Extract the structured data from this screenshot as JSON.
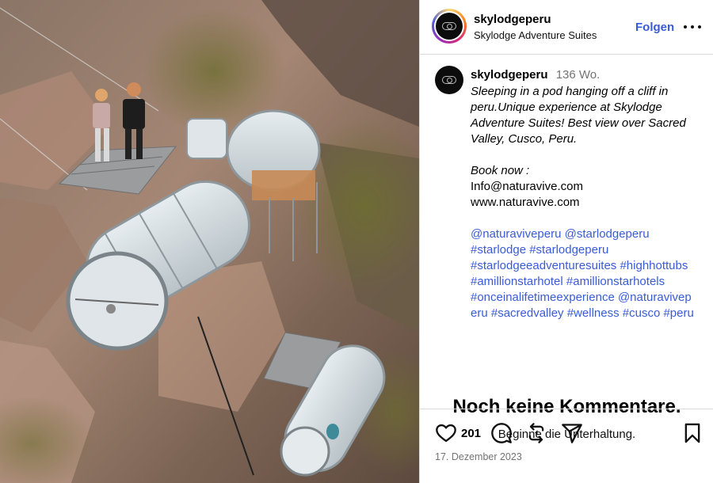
{
  "header": {
    "username": "skylodgeperu",
    "subtitle": "Skylodge Adventure Suites",
    "follow_label": "Folgen"
  },
  "caption": {
    "username": "skylodgeperu",
    "time_ago": "136 Wo.",
    "italic_lines": [
      "Sleeping in a pod hanging off a cliff in",
      "peru.Unique experience at Skylodge",
      "Adventure Suites!  Best view over Sacred",
      "Valley, Cusco, Peru."
    ],
    "book_now": "Book now :",
    "email": "Info@naturavive.com",
    "website": "www.naturavive.com",
    "hashtag_lines": [
      "@naturaviveperu @starlodgeperu",
      "#starlodge #starlodgeperu",
      "#starlodgeeadventuresuites #highhottubs",
      "#amillionstarhotel #amillionstarhotels",
      "#onceinalifetimeexperience @naturavivep",
      "eru #sacredvalley #wellness #cusco #peru"
    ]
  },
  "comments": {
    "empty_title": "Noch keine Kommentare.",
    "empty_subtitle": "Beginne die Unterhaltung."
  },
  "actions": {
    "like_count": "201",
    "date": "17. Dezember 2023",
    "icons": [
      "heart-icon",
      "comment-icon",
      "repost-icon",
      "share-icon",
      "bookmark-icon"
    ]
  },
  "colors": {
    "link": "#3a5bd8",
    "muted": "#737373",
    "border": "#dbdbdb"
  }
}
